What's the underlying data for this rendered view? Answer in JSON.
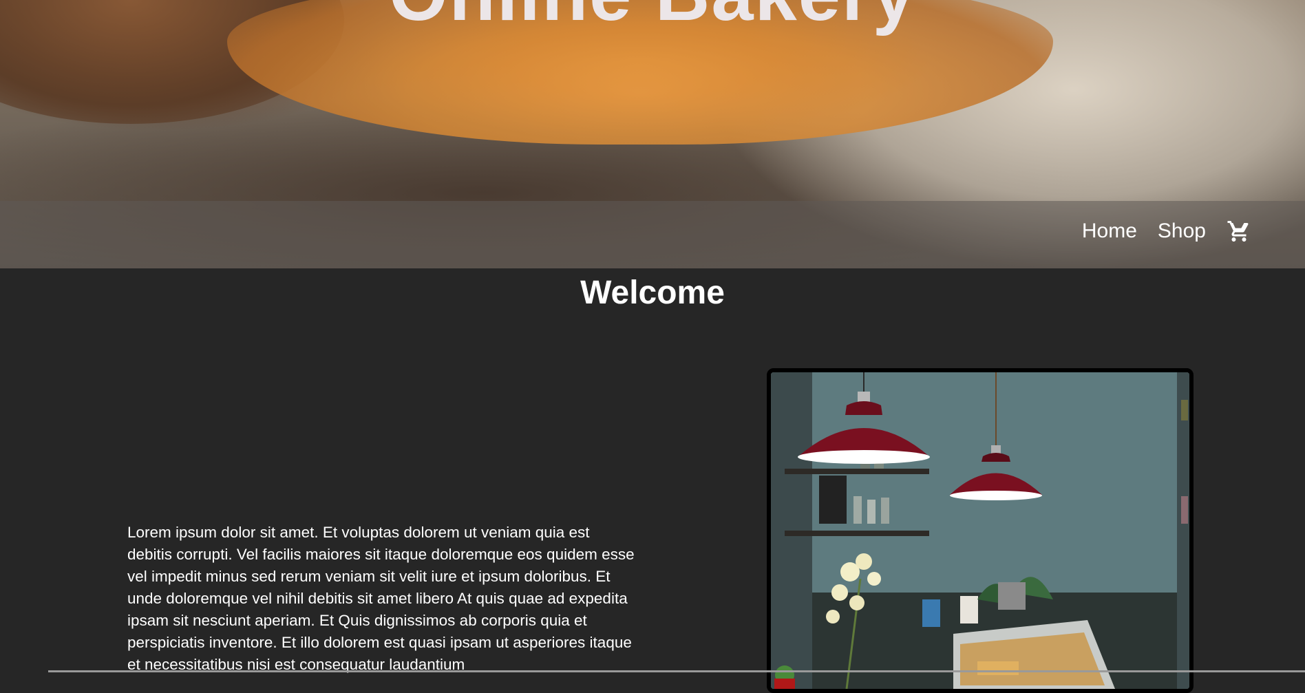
{
  "header": {
    "site_title": "Online Bakery"
  },
  "nav": {
    "items": [
      {
        "label": "Home"
      },
      {
        "label": "Shop"
      }
    ],
    "cart_icon": "shopping-cart-icon"
  },
  "main": {
    "heading": "Welcome",
    "intro_paragraph": "Lorem ipsum dolor sit amet. Et voluptas dolorem ut veniam quia est debitis corrupti. Vel facilis maiores sit itaque doloremque eos quidem esse vel impedit minus sed rerum veniam sit velit iure et ipsum doloribus. Et unde doloremque vel nihil debitis sit amet libero At quis quae ad expedita ipsam sit nesciunt aperiam. Et Quis dignissimos ab corporis quia et perspiciatis inventore. Et illo dolorem est quasi ipsam ut asperiores itaque et necessitatibus nisi est consequatur laudantium"
  },
  "colors": {
    "page_background": "#262626",
    "text": "#ffffff",
    "lamp_red": "#7a1020"
  }
}
